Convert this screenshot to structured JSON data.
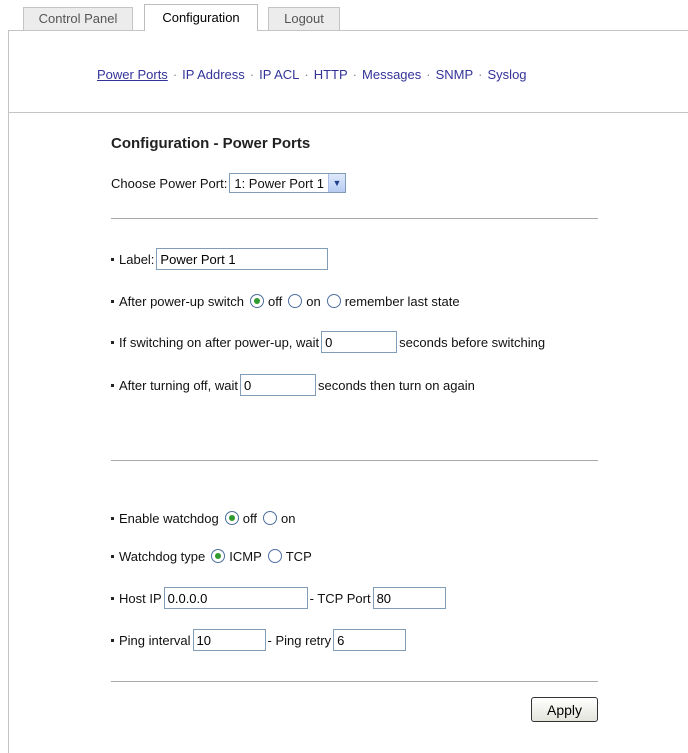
{
  "tabs": [
    "Control Panel",
    "Configuration",
    "Logout"
  ],
  "subnav": [
    "Power Ports",
    "IP Address",
    "IP ACL",
    "HTTP",
    "Messages",
    "SNMP",
    "Syslog"
  ],
  "subnav_sep": "·",
  "page_title": "Configuration - Power Ports",
  "choose_port": {
    "label": "Choose Power Port:",
    "selected": "1: Power Port 1"
  },
  "label_field": {
    "label": "Label:",
    "value": "Power Port 1"
  },
  "powerup": {
    "label": "After power-up switch",
    "options": [
      "off",
      "on",
      "remember last state"
    ],
    "selected": "off"
  },
  "wait_on": {
    "label": "If switching on after power-up, wait",
    "value": "0",
    "suffix": "seconds before switching"
  },
  "wait_off": {
    "label": "After turning off, wait",
    "value": "0",
    "suffix": "seconds then turn on again"
  },
  "watchdog": {
    "label": "Enable watchdog",
    "options": [
      "off",
      "on"
    ],
    "selected": "off"
  },
  "wd_type": {
    "label": "Watchdog type",
    "options": [
      "ICMP",
      "TCP"
    ],
    "selected": "ICMP"
  },
  "host": {
    "label": "Host IP",
    "value": "0.0.0.0",
    "port_label": "- TCP Port",
    "port_value": "80"
  },
  "ping": {
    "label": "Ping interval",
    "value": "10",
    "retry_label": "- Ping retry",
    "retry_value": "6"
  },
  "apply_label": "Apply"
}
